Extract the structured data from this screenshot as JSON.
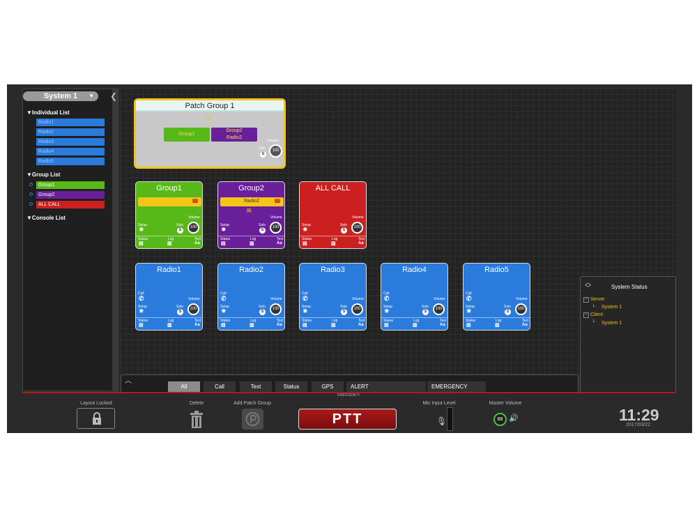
{
  "sidebar": {
    "system_select": "System 1",
    "individual_list_title": "Individual List",
    "individual_items": [
      "Radio1",
      "Radio2",
      "Radio3",
      "Radio4",
      "Radio5"
    ],
    "group_list_title": "Group List",
    "group_items": [
      {
        "label": "Group1",
        "color": "#58b81a"
      },
      {
        "label": "Group2",
        "color": "#6a1f9a"
      },
      {
        "label": "ALL CALL",
        "color": "#cc2020"
      }
    ],
    "console_list_title": "Console List"
  },
  "patch_group": {
    "title": "Patch Group 1",
    "member_group": "Group1",
    "member_combo_line1": "Group2",
    "member_combo_line2": "Radio2",
    "volume_label": "Volume",
    "solo_label": "Solo",
    "volume_value": "100"
  },
  "group_tiles": [
    {
      "name": "Group1",
      "color": "green",
      "call_text": "",
      "volume": "100"
    },
    {
      "name": "Group2",
      "color": "purple",
      "call_text": "Radio2",
      "volume": "100"
    },
    {
      "name": "ALL CALL",
      "color": "red",
      "call_text": "",
      "volume": "100"
    }
  ],
  "radio_tiles": [
    {
      "name": "Radio1",
      "volume": "100"
    },
    {
      "name": "Radio2",
      "volume": "100"
    },
    {
      "name": "Radio3",
      "volume": "100"
    },
    {
      "name": "Radio4",
      "volume": "100"
    },
    {
      "name": "Radio5",
      "volume": "100"
    }
  ],
  "tile_labels": {
    "setup": "Setup",
    "solo": "Solo",
    "volume": "Volume",
    "status": "Status",
    "log": "Log",
    "text": "Text",
    "call": "Call",
    "text_icon": "Aa"
  },
  "system_status": {
    "title": "System Status",
    "server_label": "Server",
    "server_child": "System 1",
    "client_label": "Client",
    "client_child": "System 1"
  },
  "filter_tabs": [
    "All",
    "Call",
    "Text",
    "Status",
    "GPS"
  ],
  "filter_active": "All",
  "alert_tab": "ALERT",
  "emergency_tab": "EMERGENCY",
  "emergency_small": "EMERGENCY",
  "footer": {
    "layout_locked": "Layout Locked",
    "delete": "Delete",
    "add_patch_group": "Add Patch Group",
    "ptt": "PTT",
    "mic_input_level": "Mic Input Level",
    "master_volume": "Master Volume",
    "master_volume_value": "88",
    "time": "11:29",
    "date": "2017/03/22"
  }
}
